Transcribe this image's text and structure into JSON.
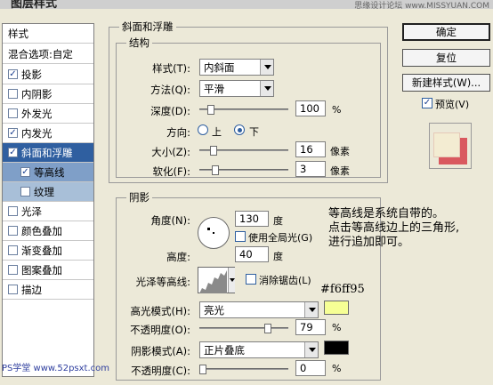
{
  "window": {
    "title": "图层样式",
    "watermark": "思缘设计论坛 www.MISSYUAN.COM"
  },
  "style_list": {
    "header": "样式",
    "blend": "混合选项:自定",
    "items": [
      {
        "label": "投影",
        "checked": true
      },
      {
        "label": "内阴影",
        "checked": false
      },
      {
        "label": "外发光",
        "checked": false
      },
      {
        "label": "内发光",
        "checked": true
      },
      {
        "label": "斜面和浮雕",
        "checked": true
      },
      {
        "label": "等高线",
        "checked": true
      },
      {
        "label": "纹理",
        "checked": false
      },
      {
        "label": "光泽",
        "checked": false
      },
      {
        "label": "颜色叠加",
        "checked": false
      },
      {
        "label": "渐变叠加",
        "checked": false
      },
      {
        "label": "图案叠加",
        "checked": false
      },
      {
        "label": "描边",
        "checked": false
      }
    ],
    "footer_watermark": "PS学堂 www.52psxt.com"
  },
  "bevel": {
    "title": "斜面和浮雕",
    "structure": {
      "title": "结构",
      "style_label": "样式(T):",
      "style_value": "内斜面",
      "technique_label": "方法(Q):",
      "technique_value": "平滑",
      "depth_label": "深度(D):",
      "depth_value": "100",
      "depth_fraction": 0.1,
      "depth_unit": "%",
      "direction_label": "方向:",
      "direction_up": "上",
      "direction_down": "下",
      "size_label": "大小(Z):",
      "size_value": "16",
      "size_unit": "像素",
      "soften_label": "软化(F):",
      "soften_value": "3",
      "soften_unit": "像素"
    },
    "shading": {
      "title": "阴影",
      "angle_label": "角度(N):",
      "angle_value": "130",
      "angle_unit": "度",
      "global_light_label": "使用全局光(G)",
      "altitude_label": "高度:",
      "altitude_value": "40",
      "altitude_unit": "度",
      "gloss_label": "光泽等高线:",
      "antialias_label": "消除锯齿(L)",
      "highlight_label": "高光模式(H):",
      "highlight_mode": "亮光",
      "highlight_color": "#f6ff95",
      "highlight_opacity_label": "不透明度(O):",
      "highlight_opacity": "79",
      "highlight_opacity_unit": "%",
      "shadow_label": "阴影模式(A):",
      "shadow_mode": "正片叠底",
      "shadow_color": "#000000",
      "shadow_opacity_label": "不透明度(C):",
      "shadow_opacity": "0",
      "shadow_opacity_unit": "%"
    }
  },
  "buttons": {
    "ok": "确定",
    "reset": "复位",
    "new_style": "新建样式(W)...",
    "preview": "预览(V)"
  },
  "annotation": {
    "lines": [
      "等高线是系统自带的。",
      "点击等高线边上的三角形,",
      "进行追加即可。"
    ],
    "hex": "#f6ff95"
  }
}
